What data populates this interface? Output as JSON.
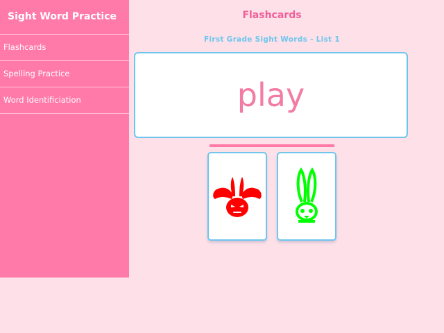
{
  "sidebar": {
    "title": "Sight Word Practice",
    "items": [
      {
        "label": "Flashcards"
      },
      {
        "label": "Spelling Practice"
      },
      {
        "label": "Word Identificiation"
      }
    ]
  },
  "main": {
    "title": "Flashcards",
    "list_title": "First Grade Sight Words - List 1",
    "word": "play",
    "cards": [
      {
        "icon": "red-rabbit-icon",
        "color": "#ff0000"
      },
      {
        "icon": "green-rabbit-icon",
        "color": "#00ff00"
      }
    ]
  },
  "colors": {
    "background": "#fde0e8",
    "sidebar": "#ff7aa8",
    "accent_pink": "#f0609a",
    "accent_blue": "#6ec6ee"
  }
}
